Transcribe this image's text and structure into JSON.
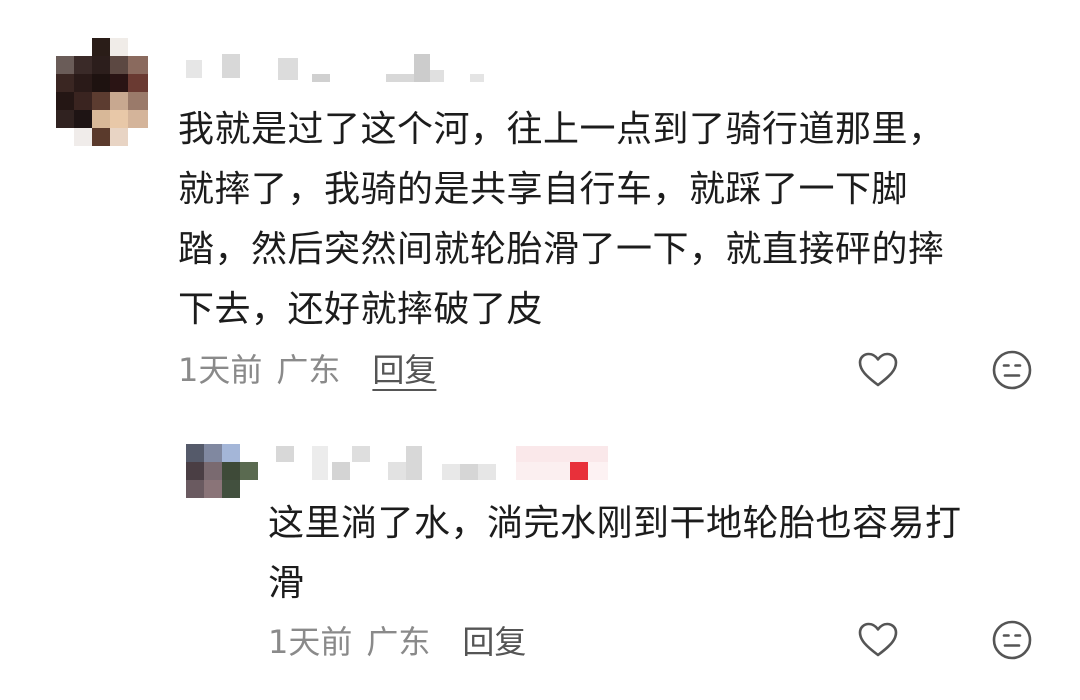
{
  "comments": [
    {
      "text": "我就是过了这个河，往上一点到了骑行道那里，\n就摔了，我骑的是共享自行车，就踩了一下脚\n踏，然后突然间就轮胎滑了一下，就直接砰的摔\n下去，还好就摔破了皮",
      "time": "1天前",
      "location": "广东",
      "reply_label": "回复",
      "like_icon": "heart-outline-icon",
      "dislike_icon": "neutral-face-icon"
    },
    {
      "text": "这里淌了水，淌完水刚到干地轮胎也容易打\n滑",
      "time": "1天前",
      "location": "广东",
      "reply_label": "回复",
      "like_icon": "heart-outline-icon",
      "dislike_icon": "neutral-face-icon"
    }
  ],
  "colors": {
    "text": "#1c1c1c",
    "meta": "#8a8a8a",
    "icon": "#555555",
    "blur_accent": "#e8303a"
  }
}
